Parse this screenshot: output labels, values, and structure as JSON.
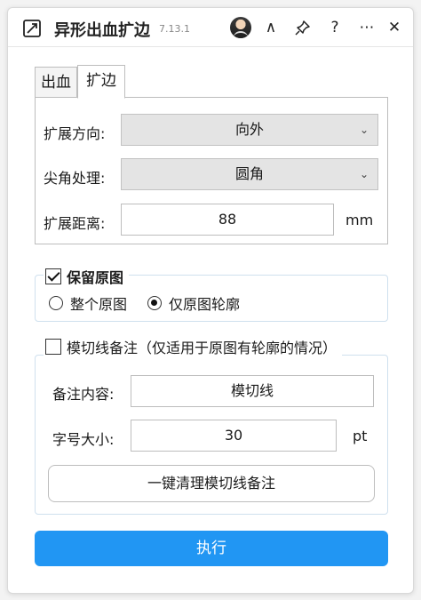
{
  "titlebar": {
    "title": "异形出血扩边",
    "version": "7.13.1",
    "btn_collapse": "∧",
    "btn_help": "?",
    "btn_more": "⋯",
    "btn_close": "✕"
  },
  "tabs": [
    {
      "label": "出血",
      "active": false
    },
    {
      "label": "扩边",
      "active": true
    }
  ],
  "expand": {
    "direction_label": "扩展方向:",
    "direction_value": "向外",
    "corner_label": "尖角处理:",
    "corner_value": "圆角",
    "distance_label": "扩展距离:",
    "distance_value": "88",
    "distance_unit": "mm"
  },
  "keep_original": {
    "label": "保留原图",
    "checked": true,
    "options": [
      "整个原图",
      "仅原图轮廓"
    ],
    "selected": "仅原图轮廓"
  },
  "cutline_note": {
    "label": "模切线备注（仅适用于原图有轮廓的情况）",
    "checked": false,
    "content_label": "备注内容:",
    "content_value": "模切线",
    "size_label": "字号大小:",
    "size_value": "30",
    "size_unit": "pt",
    "clear_button": "一键清理模切线备注"
  },
  "execute_button": "执行",
  "colors": {
    "primary": "#2196f3",
    "group_border": "#cfe0ee"
  }
}
